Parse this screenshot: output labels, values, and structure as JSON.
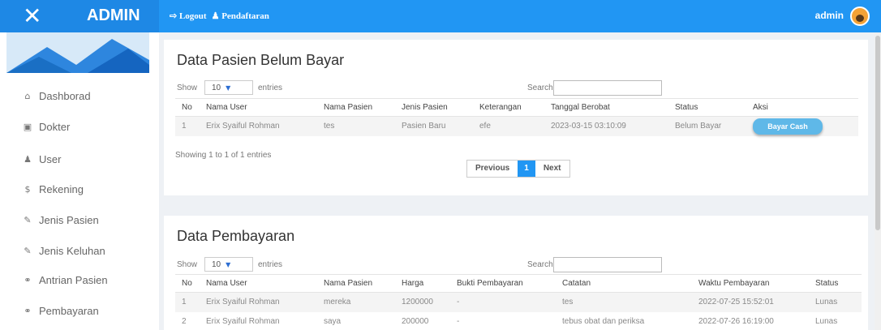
{
  "header": {
    "brand": "ADMIN",
    "close_glyph": "✕",
    "logout": "⇨ Logout",
    "register": "♟ Pendaftaran",
    "user": "admin"
  },
  "sidebar": {
    "items": [
      {
        "icon": "⌂",
        "icon_name": "home-icon",
        "label": "Dashborad"
      },
      {
        "icon": "▣",
        "icon_name": "hospital-icon",
        "label": "Dokter"
      },
      {
        "icon": "♟",
        "icon_name": "user-icon",
        "label": "User"
      },
      {
        "icon": "$",
        "icon_name": "dollar-icon",
        "label": "Rekening"
      },
      {
        "icon": "✎",
        "icon_name": "edit-icon",
        "label": "Jenis Pasien"
      },
      {
        "icon": "✎",
        "icon_name": "edit-icon",
        "label": "Jenis Keluhan"
      },
      {
        "icon": "⚭",
        "icon_name": "users-icon",
        "label": "Antrian Pasien"
      },
      {
        "icon": "⚭",
        "icon_name": "users-icon",
        "label": "Pembayaran"
      }
    ]
  },
  "unpaid": {
    "title": "Data Pasien Belum Bayar",
    "show_label": "Show",
    "entries_value": "10",
    "entries_label": "entries",
    "search_label": "Search:",
    "columns": [
      "No",
      "Nama User",
      "Nama Pasien",
      "Jenis Pasien",
      "Keterangan",
      "Tanggal Berobat",
      "Status",
      "Aksi"
    ],
    "rows": [
      {
        "no": "1",
        "nama_user": "Erix Syaiful Rohman",
        "nama_pasien": "tes",
        "jenis_pasien": "Pasien Baru",
        "keterangan": "efe",
        "tanggal": "2023-03-15 03:10:09",
        "status": "Belum Bayar",
        "aksi": "Bayar Cash"
      }
    ],
    "showing": "Showing 1 to 1 of 1 entries",
    "prev": "Previous",
    "page": "1",
    "next": "Next"
  },
  "payments": {
    "title": "Data Pembayaran",
    "show_label": "Show",
    "entries_value": "10",
    "entries_label": "entries",
    "search_label": "Search:",
    "columns": [
      "No",
      "Nama User",
      "Nama Pasien",
      "Harga",
      "Bukti Pembayaran",
      "Catatan",
      "Waktu Pembayaran",
      "Status"
    ],
    "rows": [
      {
        "no": "1",
        "nama_user": "Erix Syaiful Rohman",
        "nama_pasien": "mereka",
        "harga": "1200000",
        "bukti": "-",
        "catatan": "tes",
        "waktu": "2022-07-25 15:52:01",
        "status": "Lunas"
      },
      {
        "no": "2",
        "nama_user": "Erix Syaiful Rohman",
        "nama_pasien": "saya",
        "harga": "200000",
        "bukti": "-",
        "catatan": "tebus obat dan periksa",
        "waktu": "2022-07-26 16:19:00",
        "status": "Lunas"
      }
    ]
  }
}
